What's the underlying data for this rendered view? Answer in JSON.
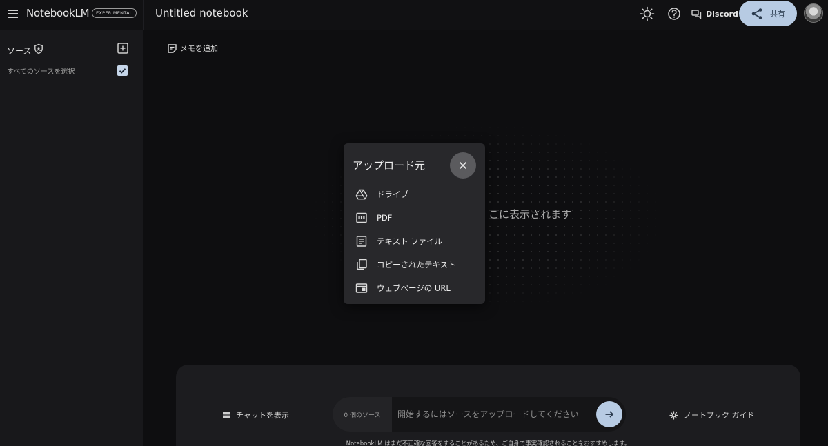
{
  "header": {
    "brand": "NotebookLM",
    "badge": "EXPERIMENTAL",
    "notebook_title": "Untitled notebook",
    "discord_label": "Discord",
    "share_label": "共有"
  },
  "sidebar": {
    "sources_title": "ソース",
    "select_all_label": "すべてのソースを選択"
  },
  "main": {
    "add_memo_label": "メモを追加",
    "empty_message": "こに表示されます"
  },
  "bottom": {
    "chat_label": "チャットを表示",
    "source_count": "0 個のソース",
    "query_placeholder": "開始するにはソースをアップロードしてください",
    "guide_label": "ノートブック ガイド",
    "disclaimer": "NotebookLM はまだ不正確な回答をすることがあるため、ご自身で事実確認されることをおすすめします。"
  },
  "upload_menu": {
    "title": "アップロード元",
    "items": [
      {
        "label": "ドライブ",
        "icon": "drive-icon"
      },
      {
        "label": "PDF",
        "icon": "pdf-icon"
      },
      {
        "label": "テキスト ファイル",
        "icon": "text-file-icon"
      },
      {
        "label": "コピーされたテキスト",
        "icon": "copy-icon"
      },
      {
        "label": "ウェブページの URL",
        "icon": "web-icon"
      }
    ]
  },
  "colors": {
    "accent": "#b7cbe3",
    "background": "#0e0e10",
    "sidebar": "#18181b",
    "popup": "#28282b"
  }
}
